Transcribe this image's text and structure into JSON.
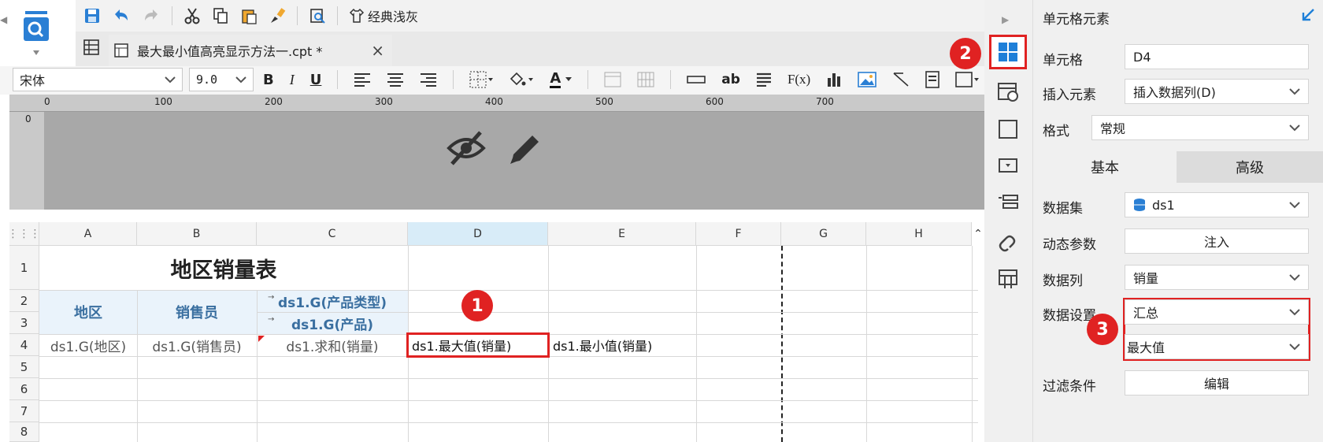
{
  "toolbar": {
    "theme_button": "经典浅灰",
    "font_name": "宋体",
    "font_size": "9.0",
    "bold": "B",
    "italic": "I",
    "underline": "U",
    "text_ab": "ab",
    "formula": "F(x)",
    "font_color_letter": "A"
  },
  "tab": {
    "title": "最大最小值高亮显示方法一.cpt *",
    "close": "×"
  },
  "ruler": {
    "marks": [
      "0",
      "100",
      "200",
      "300",
      "400",
      "500",
      "600",
      "700"
    ],
    "v_mark": "0"
  },
  "grid": {
    "columns": [
      "A",
      "B",
      "C",
      "D",
      "E",
      "F",
      "G",
      "H"
    ],
    "rows": [
      "1",
      "2",
      "3",
      "4",
      "5",
      "6",
      "7",
      "8"
    ],
    "title": "地区销量表",
    "header_region": "地区",
    "header_sales": "销售员",
    "header_product_type": "ds1.G(产品类型)",
    "header_product": "ds1.G(产品)",
    "cell_a4": "ds1.G(地区)",
    "cell_b4": "ds1.G(销售员)",
    "cell_c4": "ds1.求和(销量)",
    "cell_d4": "ds1.最大值(销量)",
    "cell_e4": "ds1.最小值(销量)"
  },
  "panel": {
    "title": "单元格元素",
    "cell_label": "单元格",
    "cell_value": "D4",
    "insert_label": "插入元素",
    "insert_value": "插入数据列(D)",
    "format_label": "格式",
    "format_value": "常规",
    "tab_basic": "基本",
    "tab_advanced": "高级",
    "dataset_label": "数据集",
    "dataset_value": "ds1",
    "param_label": "动态参数",
    "param_button": "注入",
    "column_label": "数据列",
    "column_value": "销量",
    "setting_label": "数据设置",
    "setting_value1": "汇总",
    "setting_value2": "最大值",
    "filter_label": "过滤条件",
    "filter_button": "编辑"
  },
  "badges": [
    "1",
    "2",
    "3"
  ],
  "colors": {
    "highlight_red": "#e02222",
    "header_blue_text": "#3a6fa0",
    "header_bg": "#eaf3fb",
    "panel_active_icon": "#1e7fd8"
  }
}
